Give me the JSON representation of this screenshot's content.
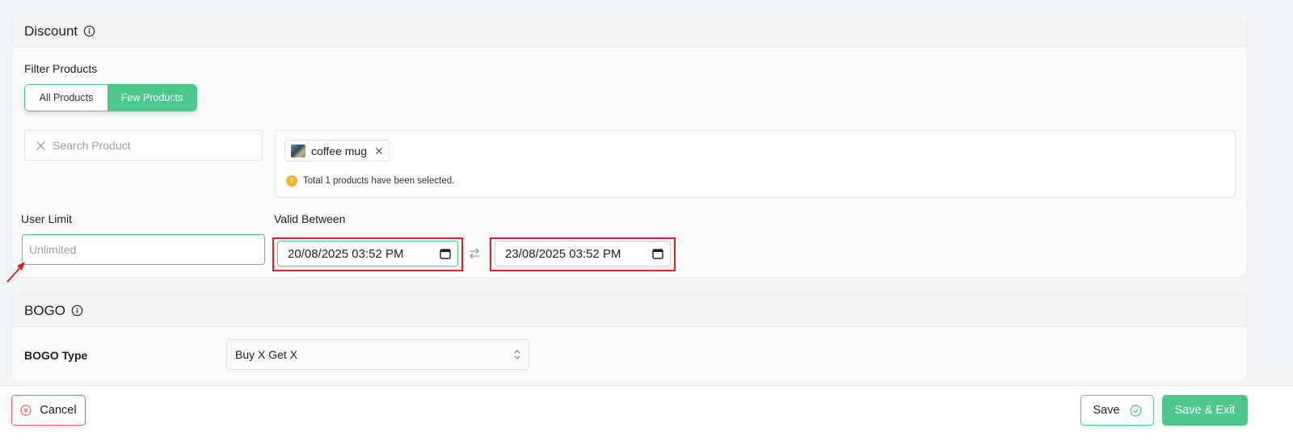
{
  "discount": {
    "title": "Discount",
    "filter_label": "Filter Products",
    "filter_options": [
      "All Products",
      "Few Products"
    ],
    "filter_selected": "Few Products",
    "search": {
      "placeholder": "Search Product"
    },
    "selected_product": "coffee mug",
    "selected_note": "Total 1 products have been selected.",
    "user_limit_label": "User Limit",
    "user_limit_placeholder": "Unlimited",
    "valid_between_label": "Valid Between",
    "start_date": "20/08/2025 03:52 PM",
    "end_date": "23/08/2025 03:52 PM"
  },
  "bogo": {
    "title": "BOGO",
    "type_label": "BOGO Type",
    "type_value": "Buy X Get X"
  },
  "footer": {
    "cancel_label": "Cancel",
    "save_label": "Save",
    "save_exit_label": "Save & Exit"
  },
  "colors": {
    "accent": "#4cc98a",
    "highlight": "#e02020",
    "warning": "#f4b324",
    "cancel_border": "#e06464"
  },
  "icons": [
    "info-icon",
    "clear-icon",
    "remove-tag-icon",
    "warning-icon",
    "calendar-icon",
    "swap-icon",
    "chevron-updown-icon",
    "cancel-circle-icon",
    "check-circle-icon"
  ]
}
